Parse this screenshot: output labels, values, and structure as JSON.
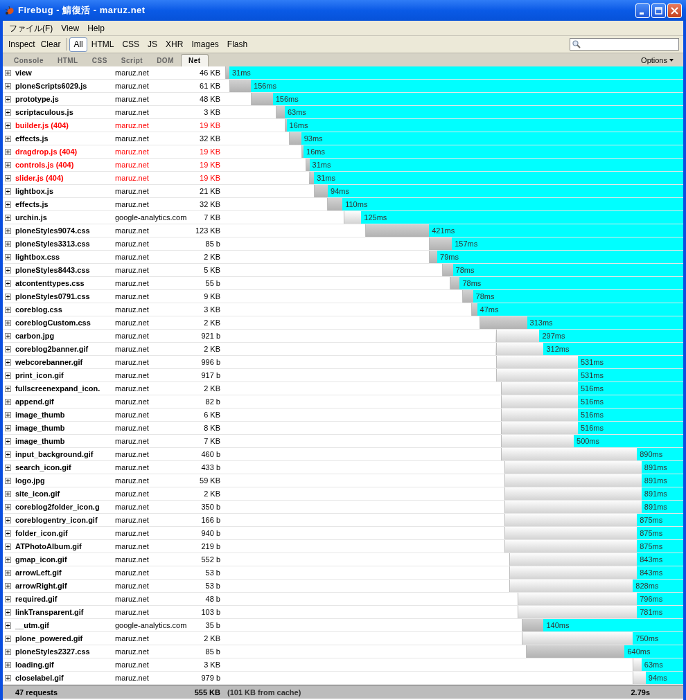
{
  "window": {
    "title": "Firebug - 鯖復活 - maruz.net"
  },
  "menu": [
    "ファイル(F)",
    "View",
    "Help"
  ],
  "toolbar": {
    "buttons": [
      "Inspect",
      "Clear"
    ],
    "filters": [
      {
        "label": "All",
        "selected": true
      },
      {
        "label": "HTML",
        "selected": false
      },
      {
        "label": "CSS",
        "selected": false
      },
      {
        "label": "JS",
        "selected": false
      },
      {
        "label": "XHR",
        "selected": false
      },
      {
        "label": "Images",
        "selected": false
      },
      {
        "label": "Flash",
        "selected": false
      }
    ]
  },
  "tabs": [
    {
      "label": "Console",
      "selected": false
    },
    {
      "label": "HTML",
      "selected": false
    },
    {
      "label": "CSS",
      "selected": false
    },
    {
      "label": "Script",
      "selected": false
    },
    {
      "label": "DOM",
      "selected": false
    },
    {
      "label": "Net",
      "selected": true
    }
  ],
  "options": "Options",
  "requests": [
    {
      "name": "view",
      "domain": "maruz.net",
      "size": "46 KB",
      "time": "31ms",
      "error": false,
      "kind": "dark",
      "start": {
        "level": 0
      },
      "end": {
        "level": 0.009
      }
    },
    {
      "name": "ploneScripts6029.js",
      "domain": "maruz.net",
      "size": "61 KB",
      "time": "156ms",
      "error": false,
      "kind": "dark",
      "start": {
        "level": 0.009
      },
      "end": {
        "level": 0.056
      }
    },
    {
      "name": "prototype.js",
      "domain": "maruz.net",
      "size": "48 KB",
      "time": "156ms",
      "error": false,
      "kind": "dark",
      "start": {
        "level": 0.056
      },
      "end": {
        "level": 0.104
      }
    },
    {
      "name": "scriptaculous.js",
      "domain": "maruz.net",
      "size": "3 KB",
      "time": "63ms",
      "error": false,
      "kind": "dark",
      "start": {
        "level": 0.111
      },
      "end": {
        "level": 0.13
      }
    },
    {
      "name": "builder.js (404)",
      "domain": "maruz.net",
      "size": "19 KB",
      "time": "16ms",
      "error": true,
      "kind": "dark",
      "start": {
        "level": 0.13
      },
      "end": {
        "level": 0.134
      }
    },
    {
      "name": "effects.js",
      "domain": "maruz.net",
      "size": "32 KB",
      "time": "93ms",
      "error": false,
      "kind": "dark",
      "start": {
        "level": 0.139
      },
      "end": {
        "level": 0.166
      }
    },
    {
      "name": "dragdrop.js (404)",
      "domain": "maruz.net",
      "size": "19 KB",
      "time": "16ms",
      "error": true,
      "kind": "dark",
      "start": {
        "level": 0.166
      },
      "end": {
        "level": 0.171
      }
    },
    {
      "name": "controls.js (404)",
      "domain": "maruz.net",
      "size": "19 KB",
      "time": "31ms",
      "error": true,
      "kind": "dark",
      "start": {
        "level": 0.175
      },
      "end": {
        "level": 0.184
      }
    },
    {
      "name": "slider.js (404)",
      "domain": "maruz.net",
      "size": "19 KB",
      "time": "31ms",
      "error": true,
      "kind": "dark",
      "start": {
        "level": 0.184
      },
      "end": {
        "level": 0.194
      }
    },
    {
      "name": "lightbox.js",
      "domain": "maruz.net",
      "size": "21 KB",
      "time": "94ms",
      "error": false,
      "kind": "dark",
      "start": {
        "level": 0.194
      },
      "end": {
        "level": 0.224
      }
    },
    {
      "name": "effects.js",
      "domain": "maruz.net",
      "size": "32 KB",
      "time": "110ms",
      "error": false,
      "kind": "dark",
      "start": {
        "level": 0.223
      },
      "end": {
        "level": 0.256
      }
    },
    {
      "name": "urchin.js",
      "domain": "google-analytics.com",
      "size": "7 KB",
      "time": "125ms",
      "error": false,
      "kind": "light",
      "start": {
        "level": 0.259
      },
      "end": {
        "level": 0.297
      }
    },
    {
      "name": "ploneStyles9074.css",
      "domain": "maruz.net",
      "size": "123 KB",
      "time": "421ms",
      "error": false,
      "kind": "dark",
      "start": {
        "level": 0.305
      },
      "end": {
        "level": 0.445
      }
    },
    {
      "name": "ploneStyles3313.css",
      "domain": "maruz.net",
      "size": "85 b",
      "time": "157ms",
      "error": false,
      "kind": "dark",
      "start": {
        "level": 0.445
      },
      "end": {
        "level": 0.495
      }
    },
    {
      "name": "lightbox.css",
      "domain": "maruz.net",
      "size": "2 KB",
      "time": "79ms",
      "error": false,
      "kind": "dark",
      "start": {
        "level": 0.445
      },
      "end": {
        "level": 0.463
      }
    },
    {
      "name": "ploneStyles8443.css",
      "domain": "maruz.net",
      "size": "5 KB",
      "time": "78ms",
      "error": false,
      "kind": "dark",
      "start": {
        "level": 0.473
      },
      "end": {
        "level": 0.497
      }
    },
    {
      "name": "atcontenttypes.css",
      "domain": "maruz.net",
      "size": "55 b",
      "time": "78ms",
      "error": false,
      "kind": "dark",
      "start": {
        "level": 0.491
      },
      "end": {
        "level": 0.512
      }
    },
    {
      "name": "ploneStyles0791.css",
      "domain": "maruz.net",
      "size": "9 KB",
      "time": "78ms",
      "error": false,
      "kind": "dark",
      "start": {
        "level": 0.518
      },
      "end": {
        "level": 0.541
      }
    },
    {
      "name": "coreblog.css",
      "domain": "maruz.net",
      "size": "3 KB",
      "time": "47ms",
      "error": false,
      "kind": "dark",
      "start": {
        "level": 0.537
      },
      "end": {
        "level": 0.55
      }
    },
    {
      "name": "coreblogCustom.css",
      "domain": "maruz.net",
      "size": "2 KB",
      "time": "313ms",
      "error": false,
      "kind": "dark",
      "start": {
        "level": 0.555
      },
      "end": {
        "level": 0.659
      }
    },
    {
      "name": "carbon.jpg",
      "domain": "maruz.net",
      "size": "921 b",
      "time": "297ms",
      "error": false,
      "kind": "light",
      "start": {
        "level": 0.591
      },
      "end": {
        "level": 0.686
      }
    },
    {
      "name": "coreblog2banner.gif",
      "domain": "maruz.net",
      "size": "2 KB",
      "time": "312ms",
      "error": false,
      "kind": "light",
      "start": {
        "level": 0.591
      },
      "end": {
        "level": 0.695
      }
    },
    {
      "name": "webcorebanner.gif",
      "domain": "maruz.net",
      "size": "996 b",
      "time": "531ms",
      "error": false,
      "kind": "light",
      "start": {
        "level": 0.591
      },
      "end": {
        "level": 0.77
      }
    },
    {
      "name": "print_icon.gif",
      "domain": "maruz.net",
      "size": "917 b",
      "time": "531ms",
      "error": false,
      "kind": "light",
      "start": {
        "level": 0.591
      },
      "end": {
        "level": 0.77
      }
    },
    {
      "name": "fullscreenexpand_icon.",
      "domain": "maruz.net",
      "size": "2 KB",
      "time": "516ms",
      "error": false,
      "kind": "light",
      "start": {
        "level": 0.602
      },
      "end": {
        "level": 0.77
      }
    },
    {
      "name": "append.gif",
      "domain": "maruz.net",
      "size": "82 b",
      "time": "516ms",
      "error": false,
      "kind": "light",
      "start": {
        "level": 0.602
      },
      "end": {
        "level": 0.77
      }
    },
    {
      "name": "image_thumb",
      "domain": "maruz.net",
      "size": "6 KB",
      "time": "516ms",
      "error": false,
      "kind": "light",
      "start": {
        "level": 0.602
      },
      "end": {
        "level": 0.77
      }
    },
    {
      "name": "image_thumb",
      "domain": "maruz.net",
      "size": "8 KB",
      "time": "516ms",
      "error": false,
      "kind": "light",
      "start": {
        "level": 0.602
      },
      "end": {
        "level": 0.77
      }
    },
    {
      "name": "image_thumb",
      "domain": "maruz.net",
      "size": "7 KB",
      "time": "500ms",
      "error": false,
      "kind": "light",
      "start": {
        "level": 0.602
      },
      "end": {
        "level": 0.761
      }
    },
    {
      "name": "input_background.gif",
      "domain": "maruz.net",
      "size": "460 b",
      "time": "890ms",
      "error": false,
      "kind": "light",
      "start": {
        "level": 0.602
      },
      "end": {
        "level": 0.899
      }
    },
    {
      "name": "search_icon.gif",
      "domain": "maruz.net",
      "size": "433 b",
      "time": "891ms",
      "error": false,
      "kind": "light",
      "start": {
        "level": 0.61
      },
      "end": {
        "level": 0.909
      }
    },
    {
      "name": "logo.jpg",
      "domain": "maruz.net",
      "size": "59 KB",
      "time": "891ms",
      "error": false,
      "kind": "light",
      "start": {
        "level": 0.61
      },
      "end": {
        "level": 0.909
      }
    },
    {
      "name": "site_icon.gif",
      "domain": "maruz.net",
      "size": "2 KB",
      "time": "891ms",
      "error": false,
      "kind": "light",
      "start": {
        "level": 0.61
      },
      "end": {
        "level": 0.909
      }
    },
    {
      "name": "coreblog2folder_icon.g",
      "domain": "maruz.net",
      "size": "350 b",
      "time": "891ms",
      "error": false,
      "kind": "light",
      "start": {
        "level": 0.61
      },
      "end": {
        "level": 0.909
      }
    },
    {
      "name": "coreblogentry_icon.gif",
      "domain": "maruz.net",
      "size": "166 b",
      "time": "875ms",
      "error": false,
      "kind": "light",
      "start": {
        "level": 0.61
      },
      "end": {
        "level": 0.899
      }
    },
    {
      "name": "folder_icon.gif",
      "domain": "maruz.net",
      "size": "940 b",
      "time": "875ms",
      "error": false,
      "kind": "light",
      "start": {
        "level": 0.61
      },
      "end": {
        "level": 0.899
      }
    },
    {
      "name": "ATPhotoAlbum.gif",
      "domain": "maruz.net",
      "size": "219 b",
      "time": "875ms",
      "error": false,
      "kind": "light",
      "start": {
        "level": 0.61
      },
      "end": {
        "level": 0.899
      }
    },
    {
      "name": "gmap_icon.gif",
      "domain": "maruz.net",
      "size": "552 b",
      "time": "843ms",
      "error": false,
      "kind": "light",
      "start": {
        "level": 0.62
      },
      "end": {
        "level": 0.899
      }
    },
    {
      "name": "arrowLeft.gif",
      "domain": "maruz.net",
      "size": "53 b",
      "time": "843ms",
      "error": false,
      "kind": "light",
      "start": {
        "level": 0.62
      },
      "end": {
        "level": 0.899
      }
    },
    {
      "name": "arrowRight.gif",
      "domain": "maruz.net",
      "size": "53 b",
      "time": "828ms",
      "error": false,
      "kind": "light",
      "start": {
        "level": 0.62
      },
      "end": {
        "level": 0.89
      }
    },
    {
      "name": "required.gif",
      "domain": "maruz.net",
      "size": "48 b",
      "time": "796ms",
      "error": false,
      "kind": "light",
      "start": {
        "level": 0.639
      },
      "end": {
        "level": 0.899
      }
    },
    {
      "name": "linkTransparent.gif",
      "domain": "maruz.net",
      "size": "103 b",
      "time": "781ms",
      "error": false,
      "kind": "light",
      "start": {
        "level": 0.639
      },
      "end": {
        "level": 0.899
      }
    },
    {
      "name": "__utm.gif",
      "domain": "google-analytics.com",
      "size": "35 b",
      "time": "140ms",
      "error": false,
      "kind": "dark",
      "start": {
        "level": 0.648
      },
      "end": {
        "level": 0.695
      }
    },
    {
      "name": "plone_powered.gif",
      "domain": "maruz.net",
      "size": "2 KB",
      "time": "750ms",
      "error": false,
      "kind": "light",
      "start": {
        "level": 0.648
      },
      "end": {
        "level": 0.89
      }
    },
    {
      "name": "ploneStyles2327.css",
      "domain": "maruz.net",
      "size": "85 b",
      "time": "640ms",
      "error": false,
      "kind": "dark",
      "start": {
        "level": 0.657
      },
      "end": {
        "level": 0.872
      }
    },
    {
      "name": "loading.gif",
      "domain": "maruz.net",
      "size": "3 KB",
      "time": "63ms",
      "error": false,
      "kind": "light",
      "start": {
        "level": 0.89
      },
      "end": {
        "level": 0.909
      }
    },
    {
      "name": "closelabel.gif",
      "domain": "maruz.net",
      "size": "979 b",
      "time": "94ms",
      "error": false,
      "kind": "light",
      "start": {
        "level": 0.89
      },
      "end": {
        "level": 0.918
      }
    }
  ],
  "status_bar": {
    "count": "47 requests",
    "size": "555 KB",
    "cache": "(101 KB from cache)",
    "total": "2.79s"
  }
}
